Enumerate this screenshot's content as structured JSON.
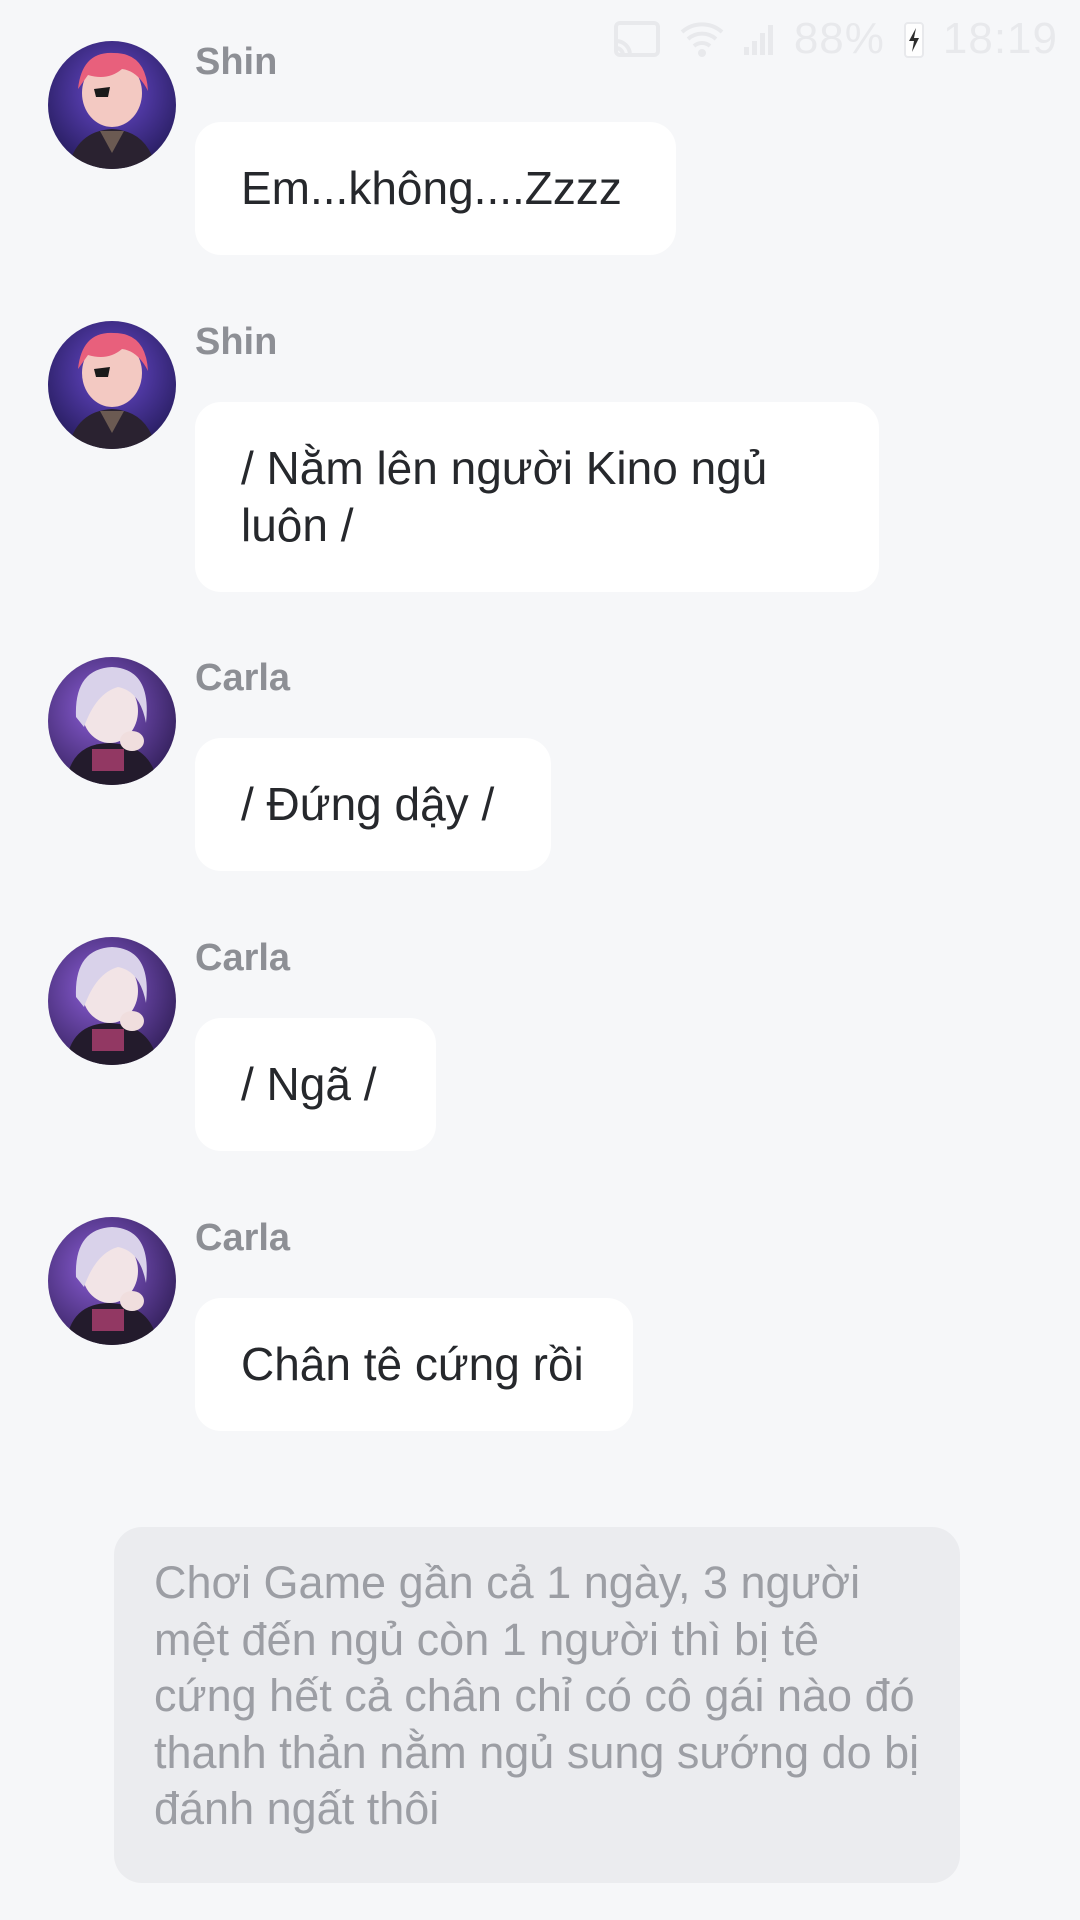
{
  "status_bar": {
    "battery_percent": "88%",
    "time": "18:19",
    "icons": [
      "cast-icon",
      "wifi-icon",
      "signal-icon",
      "battery-charging-icon"
    ]
  },
  "messages": [
    {
      "sender": "Shin",
      "text": "Em...không....Zzzz",
      "avatar": "shin-avatar"
    },
    {
      "sender": "Shin",
      "text": "/ Nằm lên người Kino ngủ luôn /",
      "avatar": "shin-avatar"
    },
    {
      "sender": "Carla",
      "text": "/ Đứng dậy /",
      "avatar": "carla-avatar"
    },
    {
      "sender": "Carla",
      "text": "/ Ngã /",
      "avatar": "carla-avatar"
    },
    {
      "sender": "Carla",
      "text": "Chân tê cứng rồi",
      "avatar": "carla-avatar"
    }
  ],
  "narration": {
    "text": "Chơi Game gần cả 1 ngày, 3 người mệt đến ngủ còn 1 người thì bị tê cứng hết cả chân chỉ có cô gái nào đó thanh thản nằm ngủ sung sướng do bị đánh ngất thôi"
  },
  "colors": {
    "background": "#f6f7f9",
    "bubble": "#ffffff",
    "narration_bg": "#ebecef",
    "sender_text": "#8d8f95",
    "message_text": "#26282c",
    "narration_text": "#9c9ea4"
  }
}
